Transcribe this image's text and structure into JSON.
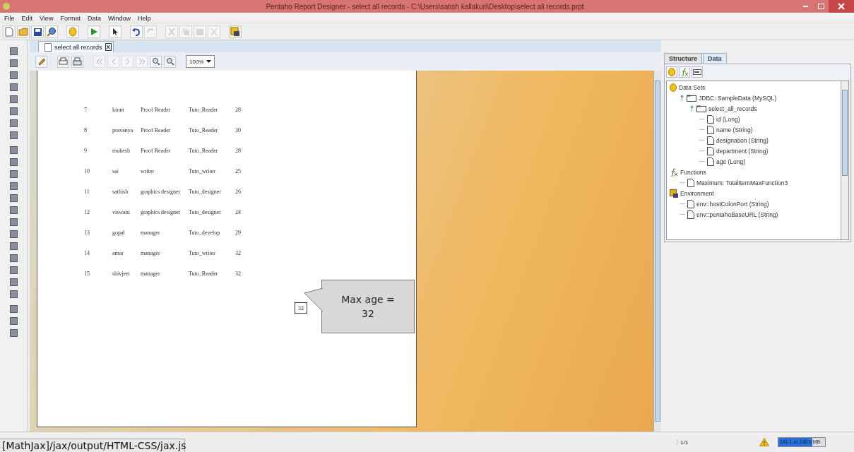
{
  "window": {
    "title": "Pentaho Report Designer - select all records - C:\\Users\\satish kallakuri\\Desktop\\select all records.prpt"
  },
  "menu": [
    "File",
    "Edit",
    "View",
    "Format",
    "Data",
    "Window",
    "Help"
  ],
  "document_tab": {
    "label": "select all records",
    "close": "X"
  },
  "zoom": {
    "value": "100%"
  },
  "report": {
    "rows": [
      {
        "id": "7",
        "name": "kiran",
        "designation": "Proof Reader",
        "department": "Tuto_Reader",
        "age": "28"
      },
      {
        "id": "8",
        "name": "pravanya",
        "designation": "Proof Reader",
        "department": "Tuto_Reader",
        "age": "30"
      },
      {
        "id": "9",
        "name": "mukesh",
        "designation": "Proof Reader",
        "department": "Tuto_Reader",
        "age": "28"
      },
      {
        "id": "10",
        "name": "sai",
        "designation": "writer",
        "department": "Tuto_writer",
        "age": "25"
      },
      {
        "id": "11",
        "name": "sathish",
        "designation": "graphics designer",
        "department": "Tuto_designer",
        "age": "26"
      },
      {
        "id": "12",
        "name": "viswani",
        "designation": "graphics designer",
        "department": "Tuto_designer",
        "age": "24"
      },
      {
        "id": "13",
        "name": "gopal",
        "designation": "manager",
        "department": "Tuto_develop",
        "age": "29"
      },
      {
        "id": "14",
        "name": "amar",
        "designation": "manager",
        "department": "Tuto_writer",
        "age": "32"
      },
      {
        "id": "15",
        "name": "shivjeet",
        "designation": "manager",
        "department": "Tuto_Reader",
        "age": "32"
      }
    ],
    "max_value": "32",
    "callout": "Max age = 32"
  },
  "panel_tabs": [
    {
      "label": "Structure",
      "selected": false
    },
    {
      "label": "Data",
      "selected": true
    }
  ],
  "tree": [
    {
      "label": "Data Sets",
      "kind": "database",
      "children": [
        {
          "label": "JDBC: SampleData (MySQL)",
          "kind": "folder",
          "expanded": true,
          "children": [
            {
              "label": "select_all_records",
              "kind": "folder",
              "expanded": true,
              "children": [
                {
                  "label": "id (Long)",
                  "kind": "field"
                },
                {
                  "label": "name (String)",
                  "kind": "field"
                },
                {
                  "label": "designation (String)",
                  "kind": "field"
                },
                {
                  "label": "department (String)",
                  "kind": "field"
                },
                {
                  "label": "age (Long)",
                  "kind": "field"
                }
              ]
            }
          ]
        }
      ]
    },
    {
      "label": "Functions",
      "kind": "function",
      "children": [
        {
          "label": "Maximum: TotalItemMaxFunction3",
          "kind": "field"
        }
      ]
    },
    {
      "label": "Environment",
      "kind": "environment",
      "children": [
        {
          "label": "env::hostColonPort (String)",
          "kind": "field"
        },
        {
          "label": "env::pentahoBaseURL (String)",
          "kind": "field"
        }
      ]
    }
  ],
  "status_bar": {
    "page": "1/1",
    "memory": {
      "reading": "141.1 of 196.0 MB",
      "level": 0.72
    }
  },
  "browser_status": "[MathJax]/jax/output/HTML-CSS/jax.js"
}
